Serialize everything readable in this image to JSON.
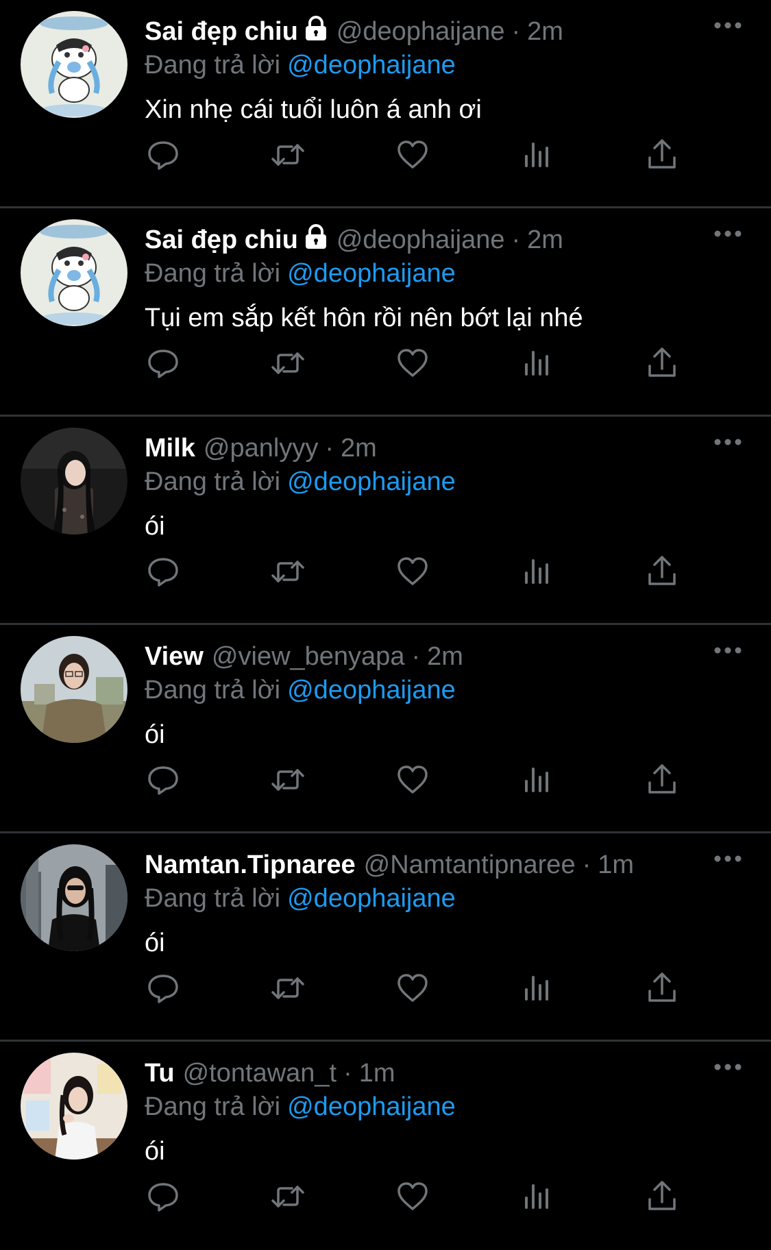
{
  "tweets": [
    {
      "name": "Sai đẹp chiu",
      "locked": true,
      "handle": "@deophaijane",
      "separator": "·",
      "time": "2m",
      "reply_label": "Đang trả lời",
      "reply_to": "@deophaijane",
      "text": "Xin nhẹ cái tuổi luôn á anh ơi",
      "avatar": "cartoon-crying-bunny"
    },
    {
      "name": "Sai đẹp chiu",
      "locked": true,
      "handle": "@deophaijane",
      "separator": "·",
      "time": "2m",
      "reply_label": "Đang trả lời",
      "reply_to": "@deophaijane",
      "text": "Tụi em sắp kết hôn rồi nên bớt lại nhé",
      "avatar": "cartoon-crying-bunny"
    },
    {
      "name": "Milk",
      "locked": false,
      "handle": "@panlyyy",
      "separator": "·",
      "time": "2m",
      "reply_label": "Đang trả lời",
      "reply_to": "@deophaijane",
      "text": "ói",
      "avatar": "photo-dark"
    },
    {
      "name": "View",
      "locked": false,
      "handle": "@view_benyapa",
      "separator": "·",
      "time": "2m",
      "reply_label": "Đang trả lời",
      "reply_to": "@deophaijane",
      "text": "ói",
      "avatar": "photo-outdoor"
    },
    {
      "name": "Namtan.Tipnaree",
      "locked": false,
      "handle": "@Namtantipnaree",
      "separator": "·",
      "time": "1m",
      "reply_label": "Đang trả lời",
      "reply_to": "@deophaijane",
      "text": "ói",
      "avatar": "photo-city"
    },
    {
      "name": "Tu",
      "locked": false,
      "handle": "@tontawan_t",
      "separator": "·",
      "time": "1m",
      "reply_label": "Đang trả lời",
      "reply_to": "@deophaijane",
      "text": "ói",
      "avatar": "photo-indoor"
    }
  ],
  "actions": [
    "reply-icon",
    "retweet-icon",
    "like-icon",
    "views-icon",
    "share-icon"
  ],
  "colors": {
    "background": "#000000",
    "text": "#ffffff",
    "secondary": "#71767b",
    "accent": "#1d9bf0",
    "divider": "#2f3336"
  }
}
